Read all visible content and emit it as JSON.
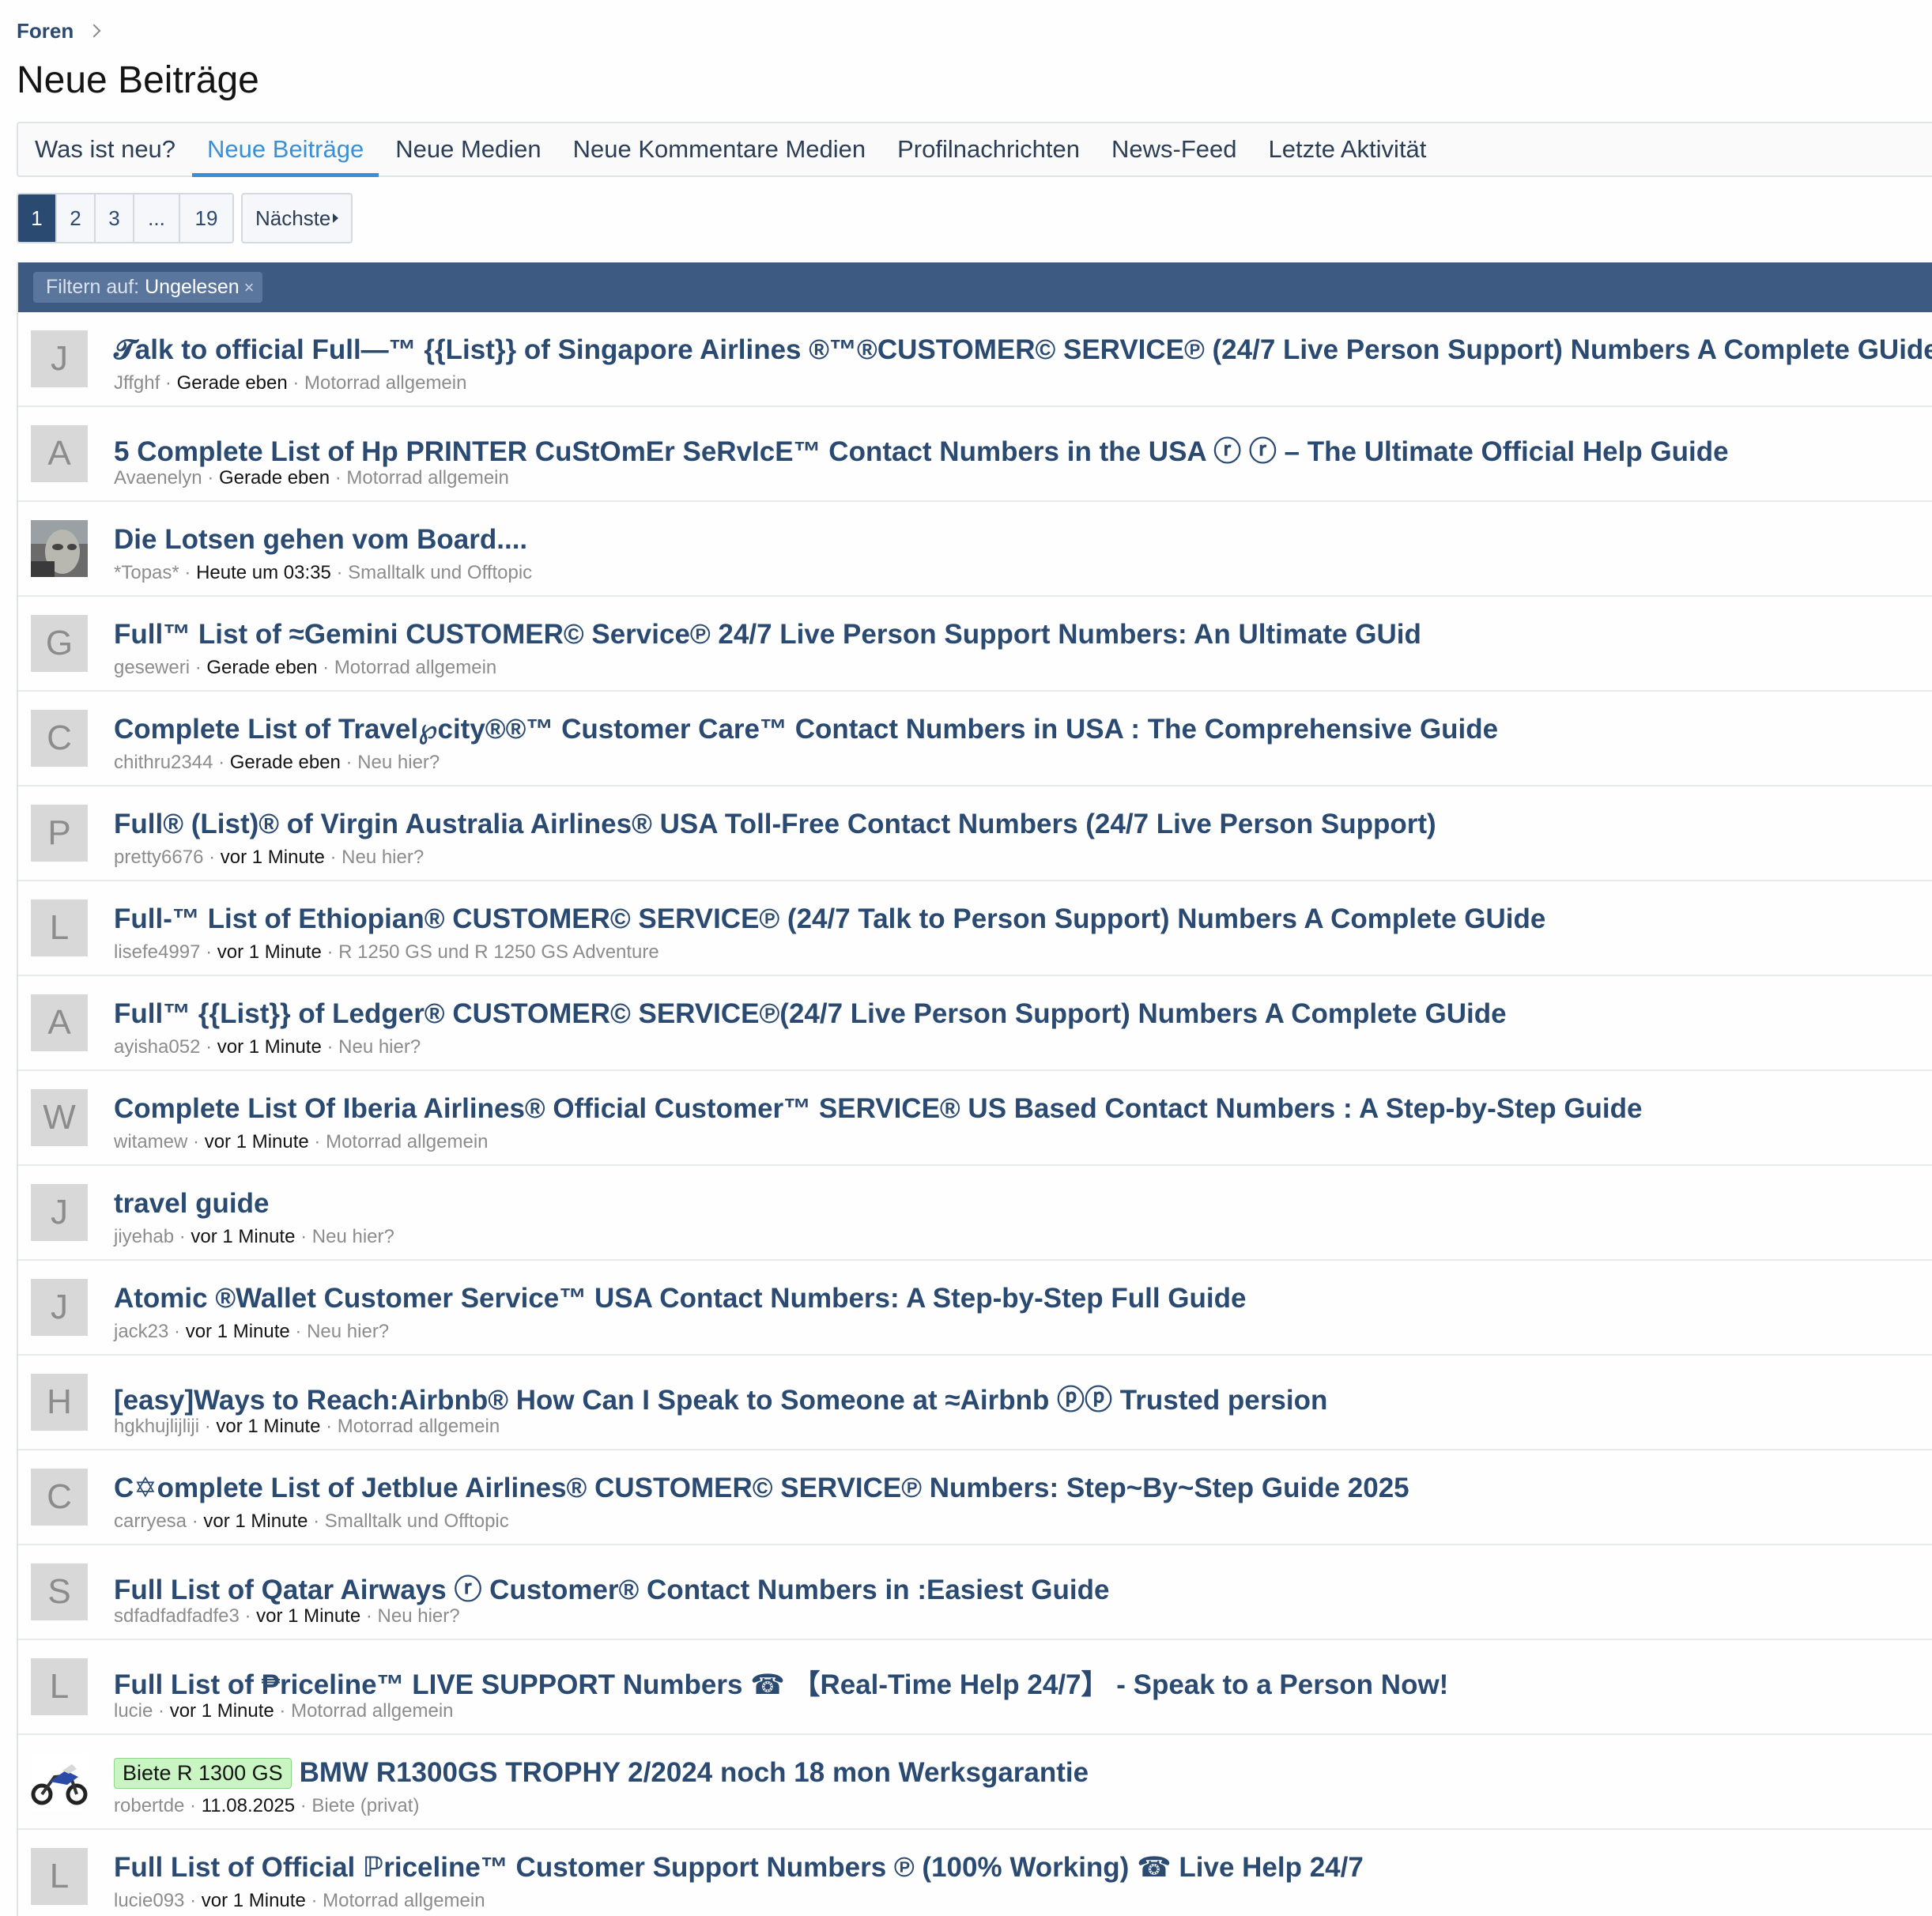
{
  "breadcrumb": {
    "root": "Foren"
  },
  "page_title": "Neue Beiträge",
  "tabs": [
    {
      "label": "Was ist neu?"
    },
    {
      "label": "Neue Beiträge"
    },
    {
      "label": "Neue Medien"
    },
    {
      "label": "Neue Kommentare Medien"
    },
    {
      "label": "Profilnachrichten"
    },
    {
      "label": "News-Feed"
    },
    {
      "label": "Letzte Aktivität"
    }
  ],
  "active_tab": "Neue Beiträge",
  "pagination": {
    "pages": [
      "1",
      "2",
      "3",
      "...",
      "19"
    ],
    "current": "1",
    "next_label": "Nächste"
  },
  "filter": {
    "label": "Filtern auf:",
    "value": "Ungelesen",
    "clear": "×"
  },
  "colors": {
    "link": "#2b4a72",
    "accent": "#3a8fd6",
    "filterbar": "#3d5a83",
    "badge_bg": "#c8f5c2"
  },
  "threads": [
    {
      "avatar": "J",
      "title": "𝓣alk to official Full—™ {{List}} of Singapore Airlines ®™®CUSTOMER© SERVICE℗ (24/7 Live Person Support) Numbers A Complete GUide",
      "author": "Jffghf",
      "time": "Gerade eben",
      "forum": "Motorrad allgemein"
    },
    {
      "avatar": "A",
      "title": "5 Complete List of Hp PRINTER CuStOmEr SeRvIcE™ Contact Numbers in the USA ⓡ ⓡ – The Ultimate Official Help Guide",
      "author": "Avaenelyn",
      "time": "Gerade eben",
      "forum": "Motorrad allgemein"
    },
    {
      "avatar": "",
      "avatar_type": "photo",
      "title": "Die Lotsen gehen vom Board....",
      "author": "*Topas*",
      "time": "Heute um 03:35",
      "forum": "Smalltalk und Offtopic"
    },
    {
      "avatar": "G",
      "title": "Full™ List of ≈Gemini CUSTOMER© Service℗ 24/7 Live Person Support Numbers: An Ultimate GUid",
      "author": "geseweri",
      "time": "Gerade eben",
      "forum": "Motorrad allgemein"
    },
    {
      "avatar": "C",
      "title": "Complete List of Travel℘city®®™ Customer Care™ Contact Numbers in USA : The Comprehensive Guide",
      "author": "chithru2344",
      "time": "Gerade eben",
      "forum": "Neu hier?"
    },
    {
      "avatar": "P",
      "title": "Full® (List)® of Virgin Australia Airlines® USA Toll-Free Contact Numbers (24/7 Live Person Support)",
      "author": "pretty6676",
      "time": "vor 1 Minute",
      "forum": "Neu hier?"
    },
    {
      "avatar": "L",
      "title": "Full-™ List of Ethiopian® CUSTOMER© SERVICE℗ (24/7 Talk to Person Support) Numbers A Complete GUide",
      "author": "lisefe4997",
      "time": "vor 1 Minute",
      "forum": "R 1250 GS und R 1250 GS Adventure"
    },
    {
      "avatar": "A",
      "title": "Full™ {{List}} of Ledger® CUSTOMER© SERVICE℗(24/7 Live Person Support) Numbers A Complete GUide",
      "author": "ayisha052",
      "time": "vor 1 Minute",
      "forum": "Neu hier?"
    },
    {
      "avatar": "W",
      "title": "Complete List Of Iberia Airlines® Official Customer™ SERVICE® US Based Contact Numbers : A Step-by-Step Guide",
      "author": "witamew",
      "time": "vor 1 Minute",
      "forum": "Motorrad allgemein"
    },
    {
      "avatar": "J",
      "title": "travel guide",
      "author": "jiyehab",
      "time": "vor 1 Minute",
      "forum": "Neu hier?"
    },
    {
      "avatar": "J",
      "title": "Atomic ®Wallet Customer Service™ USA Contact Numbers: A Step-by-Step Full Guide",
      "author": "jack23",
      "time": "vor 1 Minute",
      "forum": "Neu hier?"
    },
    {
      "avatar": "H",
      "title": "[easy]Ways to Reach:Airbnb® How Can I Speak to Someone at ≈Airbnb ⓟⓟ Trusted persion",
      "author": "hgkhujlijliji",
      "time": "vor 1 Minute",
      "forum": "Motorrad allgemein"
    },
    {
      "avatar": "C",
      "title": "C✡omplete List of Jetblue Airlines® CUSTOMER© SERVICE℗ Numbers: Step~By~Step Guide 2025",
      "author": "carryesa",
      "time": "vor 1 Minute",
      "forum": "Smalltalk und Offtopic"
    },
    {
      "avatar": "S",
      "title": "Full List of Qatar Airways ⓡ Customer® Contact Numbers in :Easiest Guide",
      "author": "sdfadfadfadfe3",
      "time": "vor 1 Minute",
      "forum": "Neu hier?"
    },
    {
      "avatar": "L",
      "title": "Full List of ₱riceline™ LIVE SUPPORT Numbers ☎ 【Real-Time Help 24/7】 - Speak to a Person Now!",
      "author": "lucie",
      "time": "vor 1 Minute",
      "forum": "Motorrad allgemein"
    },
    {
      "avatar": "",
      "avatar_type": "moto",
      "badge": "Biete R 1300 GS",
      "title": "BMW R1300GS TROPHY 2/2024 noch 18 mon Werksgarantie",
      "author": "robertde",
      "time": "11.08.2025",
      "forum": "Biete (privat)"
    },
    {
      "avatar": "L",
      "title": "Full List of Official ℙriceline™ Customer Support Numbers ℗ (100% Working) ☎ Live Help 24/7",
      "author": "lucie093",
      "time": "vor 1 Minute",
      "forum": "Motorrad allgemein"
    }
  ]
}
